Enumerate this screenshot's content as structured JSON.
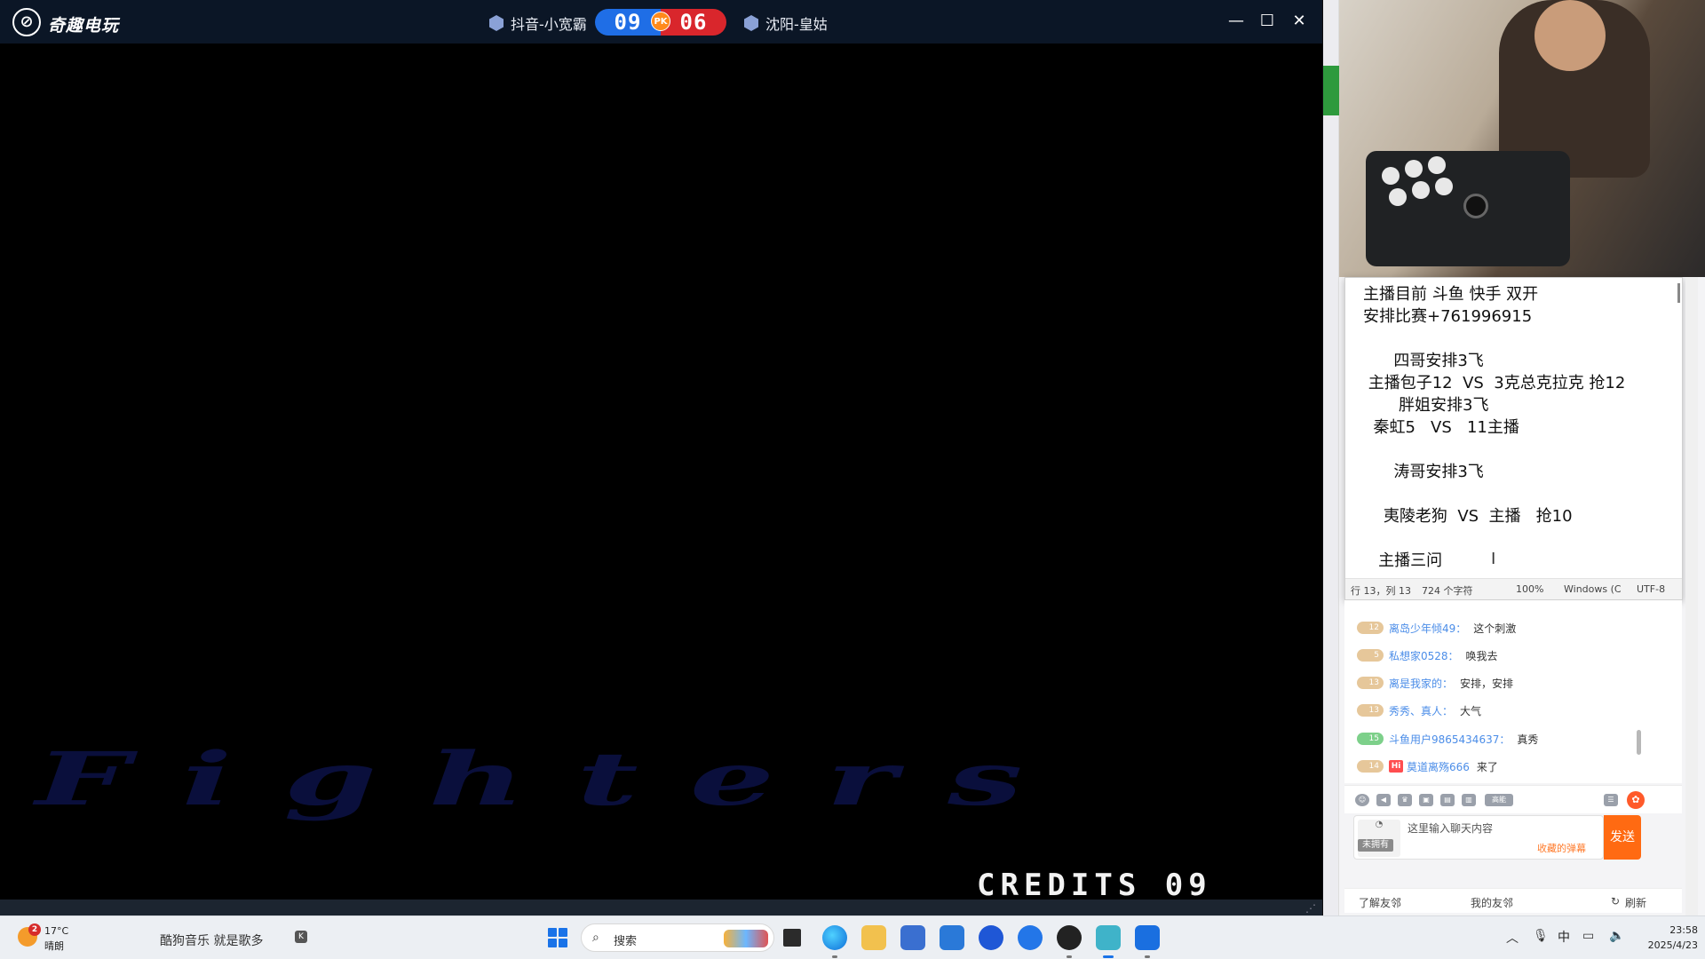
{
  "game": {
    "app_title": "奇趣电玩",
    "player_left": "抖音-小宽霸",
    "player_right": "沈阳-皇姑",
    "score_left": "09",
    "score_right": "06",
    "pk_label": "PK",
    "screen_text": "Fighters",
    "credits": "CREDITS 09",
    "minimize": "—",
    "maximize": "☐",
    "close": "✕"
  },
  "notepad": {
    "text": "主播目前 斗鱼 快手 双开\n安排比赛+761996915\n\n      四哥安排3飞\n 主播包子12  VS  3克总克拉克 抢12\n       胖姐安排3飞\n  秦虹5   VS   11主播\n\n      涛哥安排3飞\n\n    夷陵老狗  VS  主播   抢10\n\n   主播三问",
    "status_pos": "行 13，列 13",
    "status_chars": "724 个字符",
    "status_zoom": "100%",
    "status_eol": "Windows (C",
    "status_enc": "UTF-8"
  },
  "chat": {
    "messages": [
      {
        "level": "12",
        "user": "离岛少年倾49：",
        "msg": "这个刺激",
        "badge_color": "#e6c79a"
      },
      {
        "level": "5",
        "user": "私想家0528：",
        "msg": "唤我去",
        "badge_color": "#e6c79a"
      },
      {
        "level": "13",
        "user": "离是我家的：",
        "msg": "安排，安排",
        "badge_color": "#e6c79a"
      },
      {
        "level": "13",
        "user": "秀秀、真人：",
        "msg": "大气",
        "badge_color": "#e6c79a"
      },
      {
        "level": "15",
        "user": "斗鱼用户9865434637：",
        "msg": "真秀",
        "badge_color": "#7dd08a"
      },
      {
        "level": "14",
        "user": "莫道离殇666",
        "msg": "来了",
        "badge_color": "#e6c79a",
        "hi": "Hi"
      }
    ],
    "input_placeholder": "这里输入聊天内容",
    "collect_danmu": "收藏的弹幕",
    "send_label": "发送",
    "unowned": "未拥有",
    "high_energy": "高能",
    "friends_learn": "了解友邻",
    "friends_mine": "我的友邻",
    "friends_refresh": "刷新"
  },
  "taskbar": {
    "weather_badge": "2",
    "weather_temp": "17°C",
    "weather_desc": "晴朗",
    "music_text": "酷狗音乐 就是歌多",
    "music_icon": "K",
    "search_label": "搜索",
    "ime": "中",
    "time": "23:58",
    "date": "2025/4/23"
  },
  "colors": {
    "title_bar": "#0b1626",
    "score_blue": "#1f6ee6",
    "score_red": "#d9262c",
    "send_orange": "#ff6a12",
    "username_blue": "#4b8de8"
  }
}
